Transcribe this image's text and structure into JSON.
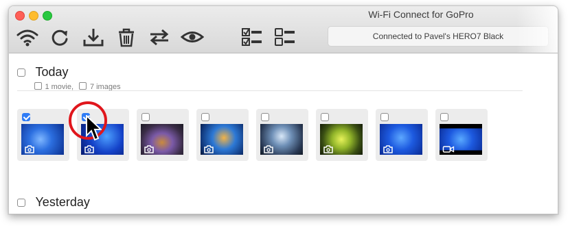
{
  "window": {
    "title": "Wi-Fi Connect for GoPro"
  },
  "toolbar": {
    "icons": [
      "wifi-icon",
      "refresh-icon",
      "download-icon",
      "trash-icon",
      "sync-icon",
      "eye-icon",
      "select-all-icon",
      "deselect-all-icon"
    ],
    "status": "Connected to Pavel's HERO7 Black"
  },
  "sections": [
    {
      "title": "Today",
      "movies": "1 movie,",
      "images": "7 images",
      "items": [
        {
          "checked": true,
          "type": "photo",
          "icon": "camera-icon"
        },
        {
          "checked": true,
          "type": "photo",
          "icon": "camera-icon"
        },
        {
          "checked": false,
          "type": "photo",
          "icon": "camera-icon"
        },
        {
          "checked": false,
          "type": "photo",
          "icon": "camera-icon"
        },
        {
          "checked": false,
          "type": "photo",
          "icon": "camera-icon"
        },
        {
          "checked": false,
          "type": "photo",
          "icon": "camera-icon"
        },
        {
          "checked": false,
          "type": "photo",
          "icon": "camera-icon"
        },
        {
          "checked": false,
          "type": "video",
          "icon": "video-camera-icon"
        }
      ]
    },
    {
      "title": "Yesterday"
    }
  ],
  "colors": {
    "accent": "#2f7cf6",
    "annotation": "#e0161c"
  }
}
